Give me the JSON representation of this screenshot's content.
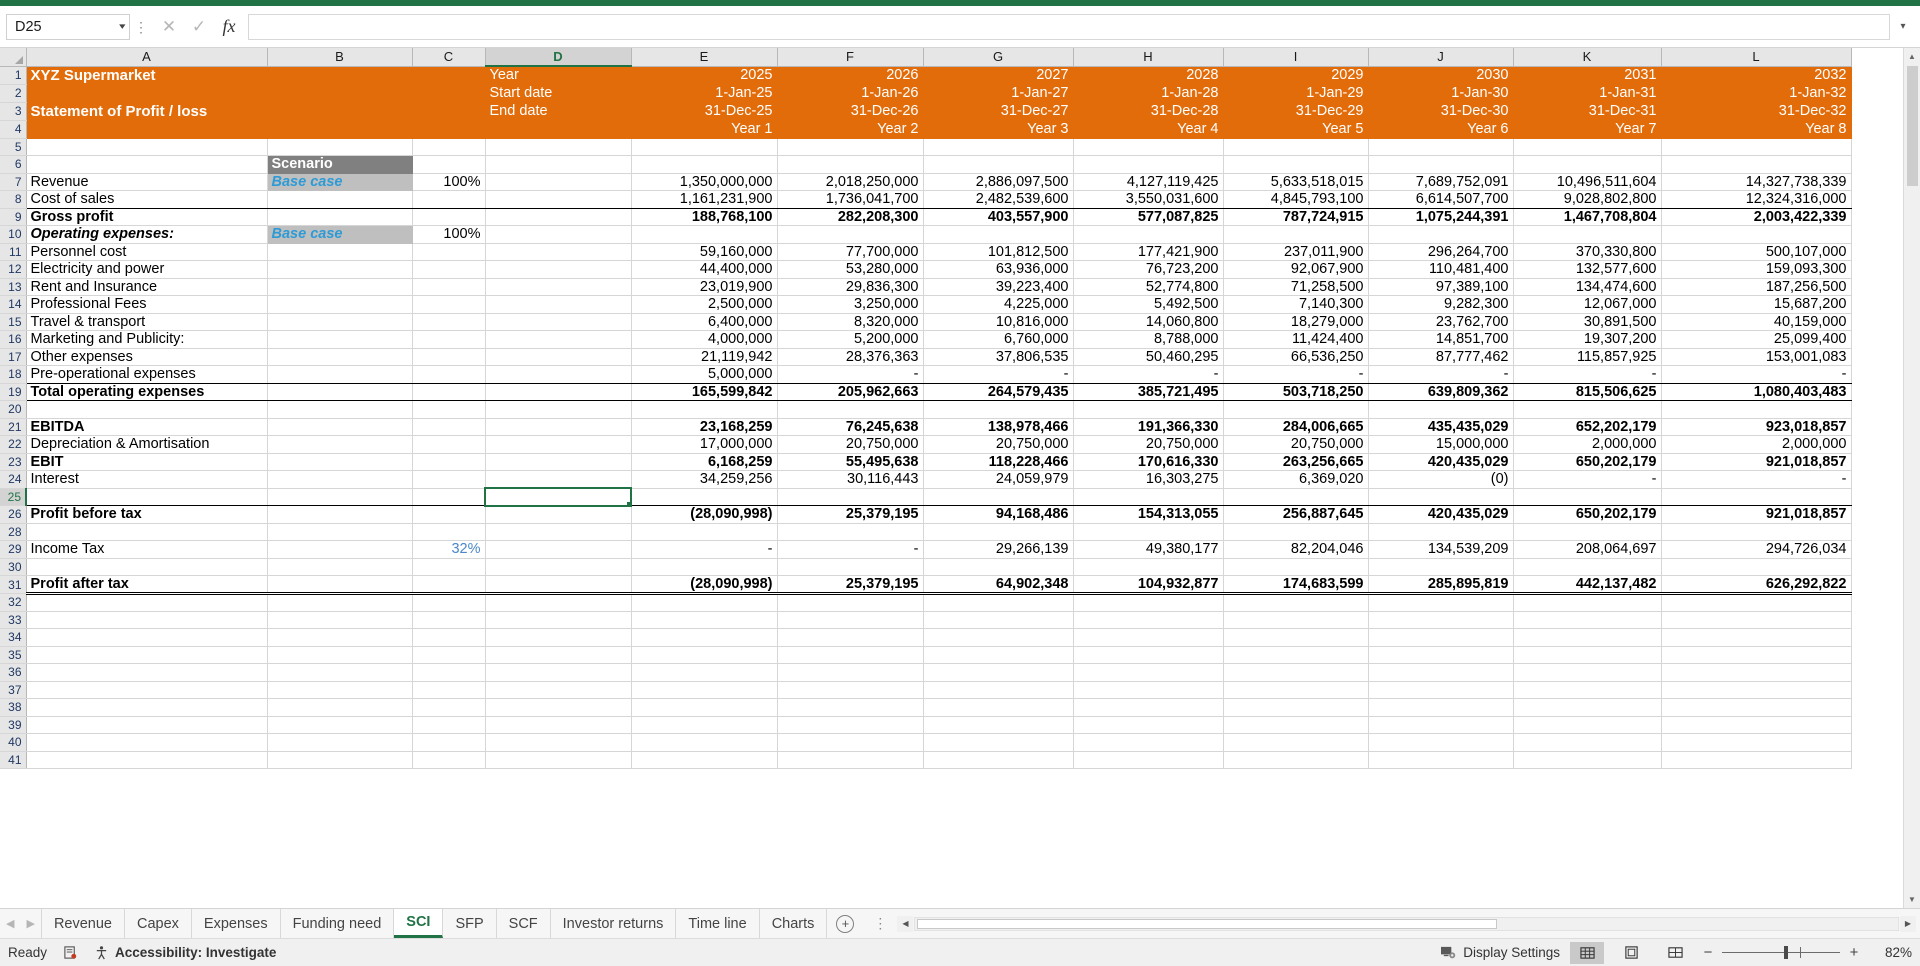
{
  "namebox": {
    "value": "D25"
  },
  "formulabar": {
    "value": "",
    "cancel_icon": "close-icon",
    "confirm_icon": "check-icon",
    "function_icon": "fx-icon"
  },
  "columns": [
    "A",
    "B",
    "C",
    "D",
    "E",
    "F",
    "G",
    "H",
    "I",
    "J",
    "K",
    "L"
  ],
  "selected_column": "D",
  "selected_row": 25,
  "row_numbers": [
    1,
    2,
    3,
    4,
    5,
    6,
    7,
    8,
    9,
    10,
    11,
    12,
    13,
    14,
    15,
    16,
    17,
    18,
    19,
    20,
    21,
    22,
    23,
    24,
    25,
    26,
    28,
    29,
    30,
    31,
    32,
    33,
    34,
    35,
    36,
    37,
    38,
    39,
    40,
    41
  ],
  "header": {
    "company": "XYZ  Supermarket",
    "statement_title": "Statement of Profit / loss",
    "labels": {
      "year": "Year",
      "start_date": "Start date",
      "end_date": "End date"
    },
    "years": [
      "2025",
      "2026",
      "2027",
      "2028",
      "2029",
      "2030",
      "2031",
      "2032"
    ],
    "start_dates": [
      "1-Jan-25",
      "1-Jan-26",
      "1-Jan-27",
      "1-Jan-28",
      "1-Jan-29",
      "1-Jan-30",
      "1-Jan-31",
      "1-Jan-32"
    ],
    "end_dates": [
      "31-Dec-25",
      "31-Dec-26",
      "31-Dec-27",
      "31-Dec-28",
      "31-Dec-29",
      "31-Dec-30",
      "31-Dec-31",
      "31-Dec-32"
    ],
    "year_labels": [
      "Year 1",
      "Year 2",
      "Year 3",
      "Year 4",
      "Year 5",
      "Year 6",
      "Year 7",
      "Year 8"
    ]
  },
  "scenario": {
    "title": "Scenario",
    "revenue_case": "Base case",
    "revenue_pct": "100%",
    "opex_case": "Base case",
    "opex_pct": "100%"
  },
  "tax_rate": "32%",
  "chart_data": {
    "type": "table",
    "title": "Statement of Profit / loss",
    "categories": [
      "Year 1",
      "Year 2",
      "Year 3",
      "Year 4",
      "Year 5",
      "Year 6",
      "Year 7",
      "Year 8"
    ],
    "series": [
      {
        "name": "Revenue",
        "values": [
          1350000000,
          2018250000,
          2886097500,
          4127119425,
          5633518015,
          7689752091,
          10496511604,
          14327738339
        ]
      },
      {
        "name": "Cost of sales",
        "values": [
          1161231900,
          1736041700,
          2482539600,
          3550031600,
          4845793100,
          6614507700,
          9028802800,
          12324316000
        ]
      },
      {
        "name": "Gross profit",
        "values": [
          188768100,
          282208300,
          403557900,
          577087825,
          787724915,
          1075244391,
          1467708804,
          2003422339
        ]
      },
      {
        "name": "Personnel cost",
        "values": [
          59160000,
          77700000,
          101812500,
          177421900,
          237011900,
          296264700,
          370330800,
          500107000
        ]
      },
      {
        "name": "Electricity and power",
        "values": [
          44400000,
          53280000,
          63936000,
          76723200,
          92067900,
          110481400,
          132577600,
          159093300
        ]
      },
      {
        "name": "Rent and Insurance",
        "values": [
          23019900,
          29836300,
          39223400,
          52774800,
          71258500,
          97389100,
          134474600,
          187256500
        ]
      },
      {
        "name": "Professional Fees",
        "values": [
          2500000,
          3250000,
          4225000,
          5492500,
          7140300,
          9282300,
          12067000,
          15687200
        ]
      },
      {
        "name": "Travel & transport",
        "values": [
          6400000,
          8320000,
          10816000,
          14060800,
          18279000,
          23762700,
          30891500,
          40159000
        ]
      },
      {
        "name": "Marketing and Publicity:",
        "values": [
          4000000,
          5200000,
          6760000,
          8788000,
          11424400,
          14851700,
          19307200,
          25099400
        ]
      },
      {
        "name": "Other expenses",
        "values": [
          21119942,
          28376363,
          37806535,
          50460295,
          66536250,
          87777462,
          115857925,
          153001083
        ]
      },
      {
        "name": "Pre-operational expenses",
        "values": [
          5000000,
          null,
          null,
          null,
          null,
          null,
          null,
          null
        ]
      },
      {
        "name": "Total operating expenses",
        "values": [
          165599842,
          205962663,
          264579435,
          385721495,
          503718250,
          639809362,
          815506625,
          1080403483
        ]
      },
      {
        "name": "EBITDA",
        "values": [
          23168259,
          76245638,
          138978466,
          191366330,
          284006665,
          435435029,
          652202179,
          923018857
        ]
      },
      {
        "name": "Depreciation & Amortisation",
        "values": [
          17000000,
          20750000,
          20750000,
          20750000,
          20750000,
          15000000,
          2000000,
          2000000
        ]
      },
      {
        "name": "EBIT",
        "values": [
          6168259,
          55495638,
          118228466,
          170616330,
          263256665,
          420435029,
          650202179,
          921018857
        ]
      },
      {
        "name": "Interest",
        "values": [
          34259256,
          30116443,
          24059979,
          16303275,
          6369020,
          0,
          null,
          null
        ]
      },
      {
        "name": "Profit before tax",
        "values": [
          -28090998,
          25379195,
          94168486,
          154313055,
          256887645,
          420435029,
          650202179,
          921018857
        ]
      },
      {
        "name": "Income Tax",
        "values": [
          null,
          null,
          29266139,
          49380177,
          82204046,
          134539209,
          208064697,
          294726034
        ]
      },
      {
        "name": "Profit after tax",
        "values": [
          -28090998,
          25379195,
          64902348,
          104932877,
          174683599,
          285895819,
          442137482,
          626292822
        ]
      }
    ],
    "xlabel": "",
    "ylabel": "",
    "legend": "none",
    "grid": true
  },
  "rows": {
    "r7": {
      "label": "Revenue",
      "values": [
        "1,350,000,000",
        "2,018,250,000",
        "2,886,097,500",
        "4,127,119,425",
        "5,633,518,015",
        "7,689,752,091",
        "10,496,511,604",
        "14,327,738,339"
      ]
    },
    "r8": {
      "label": "Cost of sales",
      "values": [
        "1,161,231,900",
        "1,736,041,700",
        "2,482,539,600",
        "3,550,031,600",
        "4,845,793,100",
        "6,614,507,700",
        "9,028,802,800",
        "12,324,316,000"
      ]
    },
    "r9": {
      "label": "Gross profit",
      "values": [
        "188,768,100",
        "282,208,300",
        "403,557,900",
        "577,087,825",
        "787,724,915",
        "1,075,244,391",
        "1,467,708,804",
        "2,003,422,339"
      ]
    },
    "r10": {
      "label": "Operating expenses:",
      "values": [
        "",
        "",
        "",
        "",
        "",
        "",
        "",
        ""
      ]
    },
    "r11": {
      "label": "Personnel cost",
      "values": [
        "59,160,000",
        "77,700,000",
        "101,812,500",
        "177,421,900",
        "237,011,900",
        "296,264,700",
        "370,330,800",
        "500,107,000"
      ]
    },
    "r12": {
      "label": "Electricity and power",
      "values": [
        "44,400,000",
        "53,280,000",
        "63,936,000",
        "76,723,200",
        "92,067,900",
        "110,481,400",
        "132,577,600",
        "159,093,300"
      ]
    },
    "r13": {
      "label": "Rent and Insurance",
      "values": [
        "23,019,900",
        "29,836,300",
        "39,223,400",
        "52,774,800",
        "71,258,500",
        "97,389,100",
        "134,474,600",
        "187,256,500"
      ]
    },
    "r14": {
      "label": "Professional Fees",
      "values": [
        "2,500,000",
        "3,250,000",
        "4,225,000",
        "5,492,500",
        "7,140,300",
        "9,282,300",
        "12,067,000",
        "15,687,200"
      ]
    },
    "r15": {
      "label": "Travel & transport",
      "values": [
        "6,400,000",
        "8,320,000",
        "10,816,000",
        "14,060,800",
        "18,279,000",
        "23,762,700",
        "30,891,500",
        "40,159,000"
      ]
    },
    "r16": {
      "label": "Marketing and Publicity:",
      "values": [
        "4,000,000",
        "5,200,000",
        "6,760,000",
        "8,788,000",
        "11,424,400",
        "14,851,700",
        "19,307,200",
        "25,099,400"
      ]
    },
    "r17": {
      "label": "Other expenses",
      "values": [
        "21,119,942",
        "28,376,363",
        "37,806,535",
        "50,460,295",
        "66,536,250",
        "87,777,462",
        "115,857,925",
        "153,001,083"
      ]
    },
    "r18": {
      "label": "Pre-operational expenses",
      "values": [
        "5,000,000",
        "-",
        "-",
        "-",
        "-",
        "-",
        "-",
        "-"
      ]
    },
    "r19": {
      "label": "Total operating expenses",
      "values": [
        "165,599,842",
        "205,962,663",
        "264,579,435",
        "385,721,495",
        "503,718,250",
        "639,809,362",
        "815,506,625",
        "1,080,403,483"
      ]
    },
    "r21": {
      "label": "EBITDA",
      "values": [
        "23,168,259",
        "76,245,638",
        "138,978,466",
        "191,366,330",
        "284,006,665",
        "435,435,029",
        "652,202,179",
        "923,018,857"
      ]
    },
    "r22": {
      "label": "Depreciation & Amortisation",
      "values": [
        "17,000,000",
        "20,750,000",
        "20,750,000",
        "20,750,000",
        "20,750,000",
        "15,000,000",
        "2,000,000",
        "2,000,000"
      ]
    },
    "r23": {
      "label": "EBIT",
      "values": [
        "6,168,259",
        "55,495,638",
        "118,228,466",
        "170,616,330",
        "263,256,665",
        "420,435,029",
        "650,202,179",
        "921,018,857"
      ]
    },
    "r24": {
      "label": "Interest",
      "values": [
        "34,259,256",
        "30,116,443",
        "24,059,979",
        "16,303,275",
        "6,369,020",
        "(0)",
        "-",
        "-"
      ]
    },
    "r26": {
      "label": "Profit before tax",
      "values": [
        "(28,090,998)",
        "25,379,195",
        "94,168,486",
        "154,313,055",
        "256,887,645",
        "420,435,029",
        "650,202,179",
        "921,018,857"
      ]
    },
    "r29": {
      "label": "Income Tax",
      "values": [
        "-",
        "-",
        "29,266,139",
        "49,380,177",
        "82,204,046",
        "134,539,209",
        "208,064,697",
        "294,726,034"
      ]
    },
    "r31": {
      "label": "Profit after tax",
      "values": [
        "(28,090,998)",
        "25,379,195",
        "64,902,348",
        "104,932,877",
        "174,683,599",
        "285,895,819",
        "442,137,482",
        "626,292,822"
      ]
    }
  },
  "sheet_tabs": {
    "items": [
      "Revenue",
      "Capex",
      "Expenses",
      "Funding need",
      "SCI",
      "SFP",
      "SCF",
      "Investor returns",
      "Time line",
      "Charts"
    ],
    "active": "SCI",
    "add_label": "+"
  },
  "statusbar": {
    "mode": "Ready",
    "accessibility": "Accessibility: Investigate",
    "display_settings": "Display Settings",
    "zoom": "82%",
    "zoom_out": "−",
    "zoom_in": "+",
    "views": [
      "normal-view",
      "page-layout-view",
      "page-break-view"
    ]
  },
  "colors": {
    "header_orange": "#E36C0A",
    "excel_green": "#217346",
    "scenario_gray": "#808080",
    "scenario_value_bg": "#BFBFBF",
    "scenario_text_blue": "#2E9BD6",
    "tax_blue": "#4a86c8"
  }
}
